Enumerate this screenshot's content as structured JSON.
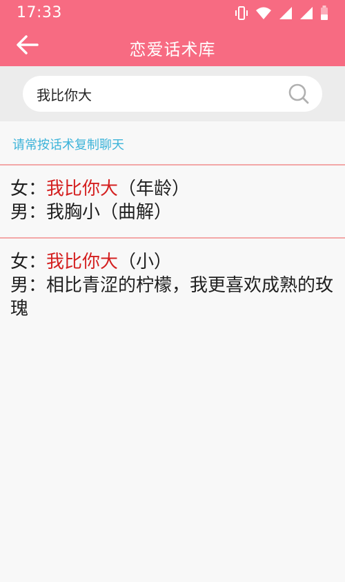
{
  "status_bar": {
    "time": "17:33"
  },
  "app_bar": {
    "title": "恋爱话术库"
  },
  "search": {
    "value": "我比你大"
  },
  "tip": "请常按话术复制聊天",
  "entries": [
    {
      "female_prefix": "女：",
      "female_highlight": "我比你大",
      "female_suffix": "（年龄）",
      "male_prefix": "男：",
      "male_text": "我胸小（曲解）"
    },
    {
      "female_prefix": "女：",
      "female_highlight": "我比你大",
      "female_suffix": "（小）",
      "male_prefix": "男：",
      "male_text": "相比青涩的柠檬，我更喜欢成熟的玫瑰"
    }
  ],
  "colors": {
    "primary": "#f76b82",
    "highlight": "#d42020",
    "tip": "#3cb3d9",
    "divider": "#f3a7a7"
  },
  "icons": {
    "status": [
      "vibrate-icon",
      "wifi-icon",
      "signal-icon",
      "signal-icon",
      "battery-icon"
    ],
    "back": "arrow-left-icon",
    "search": "search-icon"
  }
}
